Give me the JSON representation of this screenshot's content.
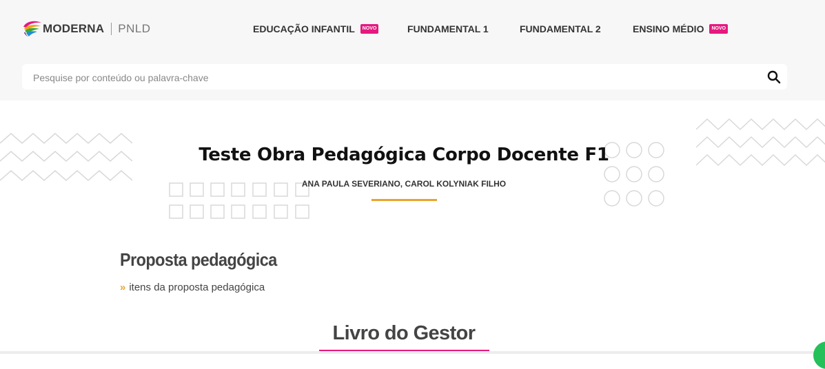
{
  "brand": {
    "name": "MODERNA",
    "product": "PNLD"
  },
  "nav": [
    {
      "label": "EDUCAÇÃO INFANTIL",
      "badge": "NOVO"
    },
    {
      "label": "FUNDAMENTAL 1"
    },
    {
      "label": "FUNDAMENTAL 2"
    },
    {
      "label": "ENSINO MÉDIO",
      "badge": "NOVO"
    }
  ],
  "search": {
    "placeholder": "Pesquise por conteúdo ou palavra-chave"
  },
  "work": {
    "title": "Teste Obra Pedagógica Corpo Docente F1",
    "authors": "ANA PAULA SEVERIANO, CAROL KOLYNIAK FILHO"
  },
  "proposal": {
    "heading": "Proposta pedagógica",
    "link": "itens da proposta pedagógica",
    "link_bullet": "»"
  },
  "gestor": {
    "heading": "Livro do Gestor"
  },
  "colors": {
    "accent_orange": "#e9a42b",
    "accent_pink": "#e6197f",
    "header_bg": "#f7f7f7"
  }
}
